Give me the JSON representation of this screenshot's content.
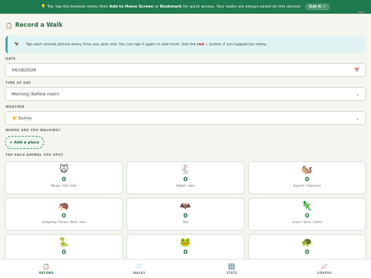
{
  "banner": {
    "icon": "lightbulb-icon",
    "tip_prefix": "💡 Tip: tap the browser menu then ",
    "add_home": "Add to Home Screen",
    "or": " or ",
    "bookmark": "Bookmark",
    "tip_suffix": " for quick access. Your walks are always saved on this device!",
    "got_it": "Got it ✓"
  },
  "title": {
    "icon": "📋",
    "text": "Record a Walk"
  },
  "tip": {
    "icon": "🦅",
    "text1": "Tap each animal picture every time you spot one. You can tap it again to add more. Use the ",
    "red": "red",
    "text2": " − button if you tapped too many."
  },
  "date": {
    "label": "DATE",
    "value": "04/18/2026"
  },
  "time_of_day": {
    "label": "TIME OF DAY",
    "value": "Morning (before noon)"
  },
  "weather": {
    "label": "WEATHER",
    "value": "☀️ Sunny"
  },
  "place": {
    "label": "WHERE ARE YOU WALKING?",
    "button": "+ Add a place"
  },
  "animals": {
    "label": "TAP EACH ANIMAL YOU SPOT",
    "items": [
      {
        "emoji": "🐭",
        "count": "0",
        "name": "Mouse / Rat / Vole"
      },
      {
        "emoji": "🐇",
        "count": "0",
        "name": "Rabbit / Hare"
      },
      {
        "emoji": "🐿️",
        "count": "0",
        "name": "Squirrel / Chipmunk"
      },
      {
        "emoji": "🦔",
        "count": "0",
        "name": "Hedgehog / Shrew / Mole / Vole"
      },
      {
        "emoji": "🦇",
        "count": "0",
        "name": "Bat"
      },
      {
        "emoji": "🦎",
        "count": "0",
        "name": "Lizard / Skink / Gecko"
      },
      {
        "emoji": "🐍",
        "count": "0",
        "name": ""
      },
      {
        "emoji": "🐸",
        "count": "0",
        "name": ""
      },
      {
        "emoji": "🐢",
        "count": "0",
        "name": ""
      }
    ]
  },
  "nav": {
    "tabs": [
      {
        "icon": "📋",
        "label": "RECORD"
      },
      {
        "icon": "📄",
        "label": "WALKS"
      },
      {
        "icon": "🔢",
        "label": "STATS"
      },
      {
        "icon": "📈",
        "label": "GRAPHS"
      }
    ]
  },
  "colors": {
    "accent": "#1f7a4d",
    "tip_bg": "#e1f3f3",
    "danger": "#c62828"
  }
}
